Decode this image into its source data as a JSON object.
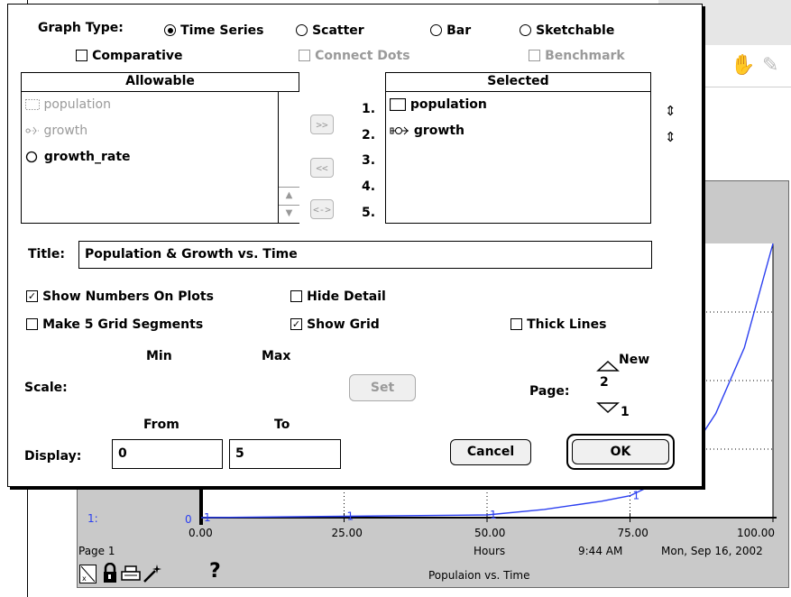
{
  "dialog": {
    "graph_type_label": "Graph Type:",
    "graph_types": [
      {
        "label": "Time Series",
        "selected": true
      },
      {
        "label": "Scatter",
        "selected": false
      },
      {
        "label": "Bar",
        "selected": false
      },
      {
        "label": "Sketchable",
        "selected": false
      }
    ],
    "comparative": {
      "label": "Comparative",
      "checked": false
    },
    "connect_dots": {
      "label": "Connect Dots",
      "checked": false,
      "enabled": false
    },
    "benchmark": {
      "label": "Benchmark",
      "checked": false,
      "enabled": false
    },
    "allowable": {
      "header": "Allowable",
      "items": [
        {
          "label": "population",
          "icon": "stock-icon",
          "enabled": false
        },
        {
          "label": "growth",
          "icon": "flow-icon",
          "enabled": false
        },
        {
          "label": "growth_rate",
          "icon": "converter-icon",
          "enabled": true
        }
      ]
    },
    "move_buttons": {
      "add": ">>",
      "remove": "<<",
      "swap": "<->"
    },
    "slot_numbers": [
      "1.",
      "2.",
      "3.",
      "4.",
      "5."
    ],
    "selected": {
      "header": "Selected",
      "items": [
        {
          "label": "population",
          "icon": "stock-icon"
        },
        {
          "label": "growth",
          "icon": "flow-icon"
        }
      ]
    },
    "title_label": "Title:",
    "title_value": "Population & Growth vs. Time",
    "show_numbers": {
      "label": "Show Numbers On Plots",
      "checked": true
    },
    "hide_detail": {
      "label": "Hide Detail",
      "checked": false
    },
    "make_grid": {
      "label": "Make 5 Grid Segments",
      "checked": false
    },
    "show_grid": {
      "label": "Show Grid",
      "checked": true
    },
    "thick_lines": {
      "label": "Thick Lines",
      "checked": false
    },
    "min_label": "Min",
    "max_label": "Max",
    "scale_label": "Scale:",
    "set_button": "Set",
    "page_label": "Page:",
    "page_new": "New",
    "page_value": "2",
    "page_below": "1",
    "from_label": "From",
    "to_label": "To",
    "display_label": "Display:",
    "display_from": "0",
    "display_to": "5",
    "cancel_button": "Cancel",
    "ok_button": "OK"
  },
  "graph": {
    "series_label": "1:",
    "y_value": "0",
    "x_ticks": [
      "0.00",
      "25.00",
      "50.00",
      "75.00",
      "100.00"
    ],
    "x_unit": "Hours",
    "page_text": "Page 1",
    "time_text": "9:44 AM",
    "date_text": "Mon, Sep 16, 2002",
    "caption": "Populaion vs. Time",
    "help_glyph": "?",
    "line_color": "#2b3ff0",
    "point_marker": "1"
  },
  "chart_data": {
    "type": "line",
    "x": [
      0,
      25,
      50,
      60,
      70,
      75,
      80,
      85,
      90,
      95,
      100
    ],
    "series": [
      {
        "name": "1",
        "values": [
          0,
          0.005,
          0.01,
          0.03,
          0.06,
          0.08,
          0.13,
          0.22,
          0.38,
          0.62,
          1.0
        ]
      }
    ],
    "xlabel": "Hours",
    "ylabel": "",
    "xlim": [
      0,
      100
    ],
    "ylim": [
      0,
      1
    ],
    "grid": true
  }
}
